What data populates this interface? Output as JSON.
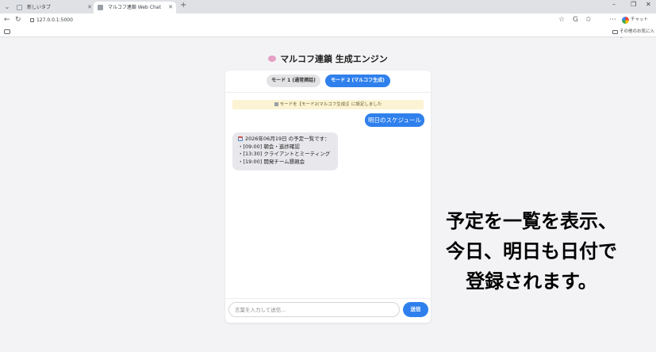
{
  "browser": {
    "tabs": [
      {
        "title": "新しいタブ",
        "active": false
      },
      {
        "title": "マルコフ連鎖 Web Chat",
        "active": true
      }
    ],
    "new_tab": "+",
    "window_controls": {
      "minimize": "–",
      "restore": "❐",
      "close": "✕"
    },
    "url": "127.0.0.1:5000",
    "chat_button": "チャット",
    "bookmarks_other": "その他のお気に入り"
  },
  "app": {
    "title": "マルコフ連鎖 生成エンジン",
    "modes": {
      "mode1": "モード 1 (通常挿話)",
      "mode2": "モード 2 (マルコフ生成)"
    },
    "notice": "モードを【モード2(マルコフ生成)】に設定しました",
    "user_message": "明日のスケジュール",
    "bot_message": {
      "header": "2026年06月19日 の予定一覧です：",
      "items": [
        "・[09:00] 朝会・進捗確認",
        "・[13:30] クライアントとミーティング",
        "・[19:00] 開発チーム懇親会"
      ]
    },
    "input_placeholder": "言葉を入力して送信...",
    "send_label": "送信"
  },
  "overlay_caption": {
    "line1": "予定を一覧を表示、",
    "line2": "今日、明日も日付で",
    "line3": "登録されます。"
  },
  "colors": {
    "accent": "#2f80ed",
    "notice_bg": "#fbf3d3",
    "bot_bubble_bg": "#e8e8ec"
  }
}
